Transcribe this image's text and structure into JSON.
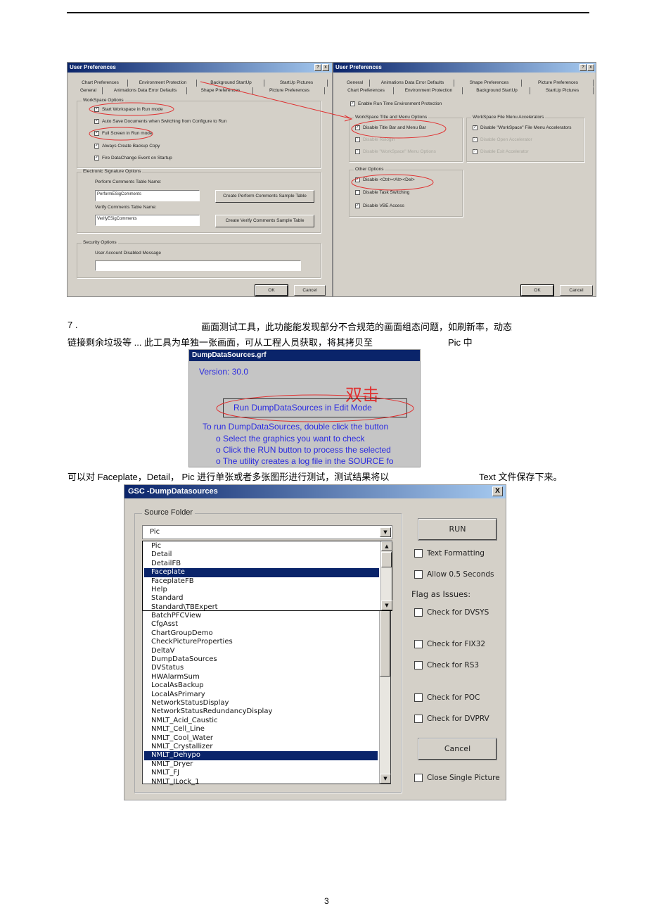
{
  "left_dialog": {
    "title": "User Preferences",
    "help": "?",
    "close": "x",
    "tabs_row1": [
      "Chart Preferences",
      "Environment Protection",
      "Background StartUp",
      "StartUp Pictures"
    ],
    "tabs_row2": [
      "General",
      "Animations Data Error Defaults",
      "Shape Preferences",
      "Picture Preferences"
    ],
    "workspace_group": "WorkSpace Options",
    "workspace_options": [
      "Start Workspace in Run mode",
      "Auto Save Documents when Switching from Configure to Run",
      "Full Screen in Run mode",
      "Always Create Backup Copy",
      "Fire DataChange Event on Startup"
    ],
    "esig_group": "Electronic Signature Options",
    "perform_label": "Perform Comments Table Name:",
    "perform_value": "PerformESigComments",
    "perform_button": "Create Perform Comments Sample Table",
    "verify_label": "Verify Comments Table Name:",
    "verify_value": "VerifyESigComments",
    "verify_button": "Create Verify Comments Sample Table",
    "security_group": "Security Options",
    "disabled_msg_label": "User Account Disabled Message",
    "disabled_msg_value": "",
    "ok": "OK",
    "cancel": "Cancel"
  },
  "right_dialog": {
    "title": "User Preferences",
    "help": "?",
    "close": "x",
    "tabs_row1": [
      "General",
      "Animations Data Error Defaults",
      "Shape Preferences",
      "Picture Preferences"
    ],
    "tabs_row2": [
      "Chart Preferences",
      "Environment Protection",
      "Background StartUp",
      "StartUp Pictures"
    ],
    "enable": "Enable Run Time Environment Protection",
    "title_group": "WorkSpace Title and Menu Options",
    "title_options": [
      "Disable Title Bar and Menu Bar",
      "Disable Relogin",
      "Disable \"WorkSpace\" Menu Options"
    ],
    "accel_group": "WorkSpace File Menu Accelerators",
    "accel_options": [
      "Disable \"WorkSpace\" File Menu Accelerators",
      "Disable Open Accelerator",
      "Disable Exit Accelerator"
    ],
    "other_group": "Other Options",
    "other_options": [
      "Disable <Ctrl><Alt><Del>",
      "Disable Task Switching",
      "Disable VBE Access"
    ],
    "ok": "OK",
    "cancel": "Cancel"
  },
  "para1": {
    "num": "7 .",
    "line1": "画面测试工具，此功能能发现部分不合规范的画面组态问题，如刷新率，动态",
    "line2a": "链接剩余垃圾等  ... 此工具为单独一张画面，可从工程人员获取，将其拷贝至",
    "line2b": "Pic 中"
  },
  "dds": {
    "title": "DumpDataSources.grf",
    "version": "Version: 30.0",
    "annotation": "双击",
    "run_button": "Run DumpDataSources in Edit Mode",
    "instructions": "To run DumpDataSources, double click the button",
    "steps": [
      "o Select the graphics you want to check",
      "o Click the RUN button to process the selected",
      "o The utility creates a log file in the SOURCE fo"
    ]
  },
  "para2": {
    "a": "可以对   Faceplate，Detail，  Pic  进行单张或者多张图形进行测试，测试结果将以",
    "b": "Text  文件保存下来。"
  },
  "gsc": {
    "title": "GSC -DumpDatasources",
    "close": "X",
    "group": "Source Folder",
    "selected_folder": "Pic",
    "folders": [
      "Pic",
      "Detail",
      "DetailFB",
      "Faceplate",
      "FaceplateFB",
      "Help",
      "Standard",
      "Standard\\TBExpert"
    ],
    "folder_selected": "Faceplate",
    "pictures": [
      "BatchPFCView",
      "CfgAsst",
      "ChartGroupDemo",
      "CheckPictureProperties",
      "DeltaV",
      "DumpDataSources",
      "DVStatus",
      "HWAlarmSum",
      "LocalAsBackup",
      "LocalAsPrimary",
      "NetworkStatusDisplay",
      "NetworkStatusRedundancyDisplay",
      "NMLT_Acid_Caustic",
      "NMLT_Cell_Line",
      "NMLT_Cool_Water",
      "NMLT_Crystallizer",
      "NMLT_Dehypo",
      "NMLT_Dryer",
      "NMLT_FJ",
      "NMLT_ILock_1"
    ],
    "picture_selected": "NMLT_Dehypo",
    "run": "RUN",
    "cancel": "Cancel",
    "text_formatting": "Text Formatting",
    "allow": "Allow 0.5 Seconds",
    "flag_label": "Flag as Issues:",
    "checks": [
      "Check for DVSYS",
      "Check for FIX32",
      "Check for RS3",
      "Check for POC",
      "Check for DVPRV"
    ],
    "close_single": "Close Single Picture"
  },
  "page_number": "3",
  "colors": {
    "annotation_red": "#e03030",
    "titlebar": "#0a246a",
    "dds_text": "#2a2ae0"
  }
}
